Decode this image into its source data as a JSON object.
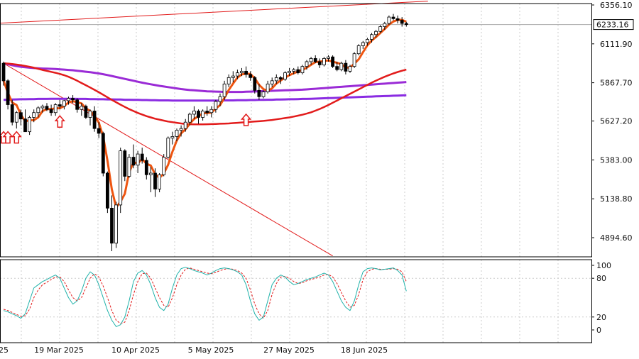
{
  "chart_data": [
    {
      "type": "candlestick",
      "title": "",
      "ylim": [
        4780,
        6380
      ],
      "y_ticks": [
        "6356.10",
        "6111.90",
        "5867.70",
        "5627.20",
        "5383.00",
        "5138.80",
        "4894.60"
      ],
      "current_price": "6233.16",
      "x_tick_labels": [
        "25",
        "19 Mar 2025",
        "10 Apr 2025",
        "5 May 2025",
        "27 May 2025",
        "18 Jun 2025"
      ],
      "grid": true,
      "colors": {
        "up": "#ffffff",
        "down": "#000000",
        "fast_ma": "#ee5511",
        "ma_50": "#e21b1b",
        "ma_200": "#9a2bd6",
        "ma_long": "#8a2be2",
        "trendline": "#e21b1b",
        "signal_arrow": "#e21b1b"
      },
      "candles": [
        [
          5990,
          6000,
          5850,
          5880
        ],
        [
          5880,
          5890,
          5700,
          5730
        ],
        [
          5730,
          5760,
          5600,
          5620
        ],
        [
          5620,
          5690,
          5580,
          5680
        ],
        [
          5680,
          5700,
          5600,
          5640
        ],
        [
          5640,
          5700,
          5560,
          5560
        ],
        [
          5560,
          5660,
          5540,
          5650
        ],
        [
          5650,
          5700,
          5620,
          5680
        ],
        [
          5680,
          5720,
          5650,
          5710
        ],
        [
          5710,
          5730,
          5680,
          5720
        ],
        [
          5720,
          5740,
          5690,
          5700
        ],
        [
          5700,
          5730,
          5660,
          5680
        ],
        [
          5680,
          5740,
          5660,
          5730
        ],
        [
          5730,
          5760,
          5700,
          5720
        ],
        [
          5720,
          5760,
          5700,
          5755
        ],
        [
          5755,
          5780,
          5730,
          5770
        ],
        [
          5770,
          5790,
          5740,
          5760
        ],
        [
          5760,
          5770,
          5680,
          5700
        ],
        [
          5700,
          5740,
          5660,
          5720
        ],
        [
          5720,
          5730,
          5640,
          5650
        ],
        [
          5650,
          5700,
          5600,
          5690
        ],
        [
          5690,
          5720,
          5560,
          5580
        ],
        [
          5580,
          5620,
          5520,
          5550
        ],
        [
          5550,
          5560,
          5280,
          5300
        ],
        [
          5300,
          5310,
          5050,
          5080
        ],
        [
          5080,
          5160,
          4810,
          4860
        ],
        [
          4860,
          5120,
          4830,
          5100
        ],
        [
          5100,
          5460,
          5050,
          5440
        ],
        [
          5440,
          5450,
          5250,
          5280
        ],
        [
          5280,
          5420,
          5270,
          5400
        ],
        [
          5400,
          5480,
          5330,
          5350
        ],
        [
          5350,
          5440,
          5300,
          5420
        ],
        [
          5420,
          5460,
          5360,
          5380
        ],
        [
          5380,
          5400,
          5260,
          5290
        ],
        [
          5290,
          5340,
          5180,
          5300
        ],
        [
          5300,
          5330,
          5150,
          5200
        ],
        [
          5200,
          5300,
          5180,
          5290
        ],
        [
          5290,
          5420,
          5280,
          5400
        ],
        [
          5400,
          5530,
          5390,
          5520
        ],
        [
          5520,
          5560,
          5480,
          5530
        ],
        [
          5530,
          5580,
          5500,
          5570
        ],
        [
          5570,
          5600,
          5530,
          5580
        ],
        [
          5580,
          5640,
          5560,
          5620
        ],
        [
          5620,
          5680,
          5600,
          5670
        ],
        [
          5670,
          5720,
          5640,
          5690
        ],
        [
          5690,
          5700,
          5610,
          5650
        ],
        [
          5650,
          5700,
          5630,
          5690
        ],
        [
          5690,
          5720,
          5660,
          5680
        ],
        [
          5680,
          5720,
          5650,
          5700
        ],
        [
          5700,
          5760,
          5680,
          5750
        ],
        [
          5750,
          5800,
          5720,
          5780
        ],
        [
          5780,
          5880,
          5760,
          5860
        ],
        [
          5860,
          5920,
          5840,
          5900
        ],
        [
          5900,
          5940,
          5870,
          5910
        ],
        [
          5910,
          5950,
          5890,
          5930
        ],
        [
          5930,
          5960,
          5910,
          5940
        ],
        [
          5940,
          5970,
          5900,
          5920
        ],
        [
          5920,
          5940,
          5880,
          5900
        ],
        [
          5900,
          5910,
          5800,
          5820
        ],
        [
          5820,
          5860,
          5760,
          5780
        ],
        [
          5780,
          5820,
          5770,
          5810
        ],
        [
          5810,
          5880,
          5800,
          5860
        ],
        [
          5860,
          5900,
          5840,
          5880
        ],
        [
          5880,
          5920,
          5860,
          5900
        ],
        [
          5900,
          5910,
          5860,
          5890
        ],
        [
          5890,
          5940,
          5880,
          5930
        ],
        [
          5930,
          5960,
          5910,
          5940
        ],
        [
          5940,
          5960,
          5920,
          5950
        ],
        [
          5950,
          5970,
          5920,
          5930
        ],
        [
          5930,
          5980,
          5920,
          5970
        ],
        [
          5970,
          6010,
          5950,
          6000
        ],
        [
          6000,
          6030,
          5980,
          6020
        ],
        [
          6020,
          6040,
          5990,
          6000
        ],
        [
          6000,
          6020,
          5960,
          5980
        ],
        [
          5980,
          6030,
          5970,
          6020
        ],
        [
          6020,
          6040,
          6000,
          6030
        ],
        [
          6030,
          6040,
          5960,
          5970
        ],
        [
          5970,
          6000,
          5940,
          5950
        ],
        [
          5950,
          6000,
          5940,
          5990
        ],
        [
          5990,
          6010,
          5920,
          5940
        ],
        [
          5940,
          5980,
          5930,
          5970
        ],
        [
          5970,
          6060,
          5960,
          6050
        ],
        [
          6050,
          6110,
          6040,
          6100
        ],
        [
          6100,
          6130,
          6080,
          6120
        ],
        [
          6120,
          6150,
          6100,
          6140
        ],
        [
          6140,
          6180,
          6120,
          6170
        ],
        [
          6170,
          6200,
          6150,
          6190
        ],
        [
          6190,
          6230,
          6180,
          6220
        ],
        [
          6220,
          6250,
          6200,
          6240
        ],
        [
          6240,
          6290,
          6230,
          6280
        ],
        [
          6280,
          6300,
          6260,
          6270
        ],
        [
          6270,
          6290,
          6240,
          6260
        ],
        [
          6260,
          6280,
          6220,
          6240
        ],
        [
          6240,
          6250,
          6220,
          6233
        ]
      ],
      "ma_50_values": [
        5990,
        5988,
        5985,
        5982,
        5978,
        5973,
        5968,
        5962,
        5955,
        5948,
        5942,
        5936,
        5930,
        5923,
        5915,
        5905,
        5893,
        5880,
        5866,
        5852,
        5838,
        5823,
        5808,
        5792,
        5776,
        5760,
        5745,
        5730,
        5716,
        5702,
        5690,
        5678,
        5668,
        5658,
        5650,
        5642,
        5636,
        5630,
        5624,
        5620,
        5616,
        5612,
        5609,
        5607,
        5606,
        5606,
        5606,
        5607,
        5608,
        5609,
        5610,
        5611,
        5612,
        5614,
        5616,
        5618,
        5620,
        5622,
        5624,
        5626,
        5628,
        5631,
        5634,
        5638,
        5642,
        5646,
        5650,
        5655,
        5661,
        5667,
        5674,
        5682,
        5692,
        5703,
        5715,
        5728,
        5742,
        5756,
        5770,
        5784,
        5798,
        5812,
        5826,
        5840,
        5854,
        5868,
        5881,
        5893,
        5905,
        5916,
        5926,
        5935,
        5943,
        5950
      ],
      "ma_200_values": [
        5990,
        5984,
        5978,
        5972,
        5968,
        5965,
        5962,
        5960,
        5958,
        5957,
        5956,
        5955,
        5954,
        5952,
        5950,
        5948,
        5946,
        5943,
        5940,
        5937,
        5934,
        5930,
        5926,
        5921,
        5916,
        5910,
        5904,
        5898,
        5892,
        5886,
        5880,
        5874,
        5868,
        5863,
        5858,
        5853,
        5848,
        5844,
        5840,
        5836,
        5832,
        5828,
        5825,
        5822,
        5820,
        5818,
        5816,
        5814,
        5813,
        5812,
        5811,
        5810,
        5810,
        5810,
        5810,
        5810,
        5811,
        5812,
        5813,
        5814,
        5815,
        5816,
        5817,
        5818,
        5819,
        5820,
        5821,
        5822,
        5823,
        5824,
        5826,
        5828,
        5830,
        5832,
        5834,
        5836,
        5838,
        5840,
        5842,
        5844,
        5846,
        5848,
        5850,
        5852,
        5854,
        5856,
        5858,
        5860,
        5862,
        5864,
        5866,
        5868,
        5870,
        5872
      ],
      "ma_long_values": [
        5760,
        5761,
        5762,
        5763,
        5764,
        5764,
        5765,
        5765,
        5766,
        5766,
        5766,
        5767,
        5767,
        5767,
        5767,
        5767,
        5767,
        5766,
        5766,
        5766,
        5765,
        5765,
        5764,
        5764,
        5763,
        5763,
        5762,
        5762,
        5761,
        5761,
        5760,
        5760,
        5759,
        5759,
        5758,
        5758,
        5757,
        5757,
        5757,
        5756,
        5756,
        5756,
        5756,
        5756,
        5756,
        5756,
        5756,
        5756,
        5756,
        5756,
        5756,
        5757,
        5757,
        5757,
        5758,
        5758,
        5758,
        5759,
        5759,
        5760,
        5760,
        5761,
        5761,
        5762,
        5762,
        5763,
        5764,
        5764,
        5765,
        5766,
        5766,
        5767,
        5768,
        5769,
        5770,
        5771,
        5772,
        5773,
        5774,
        5775,
        5776,
        5777,
        5778,
        5779,
        5780,
        5781,
        5782,
        5783,
        5784,
        5785,
        5786,
        5787,
        5788,
        5789
      ],
      "signal_arrows": [
        [
          0,
          5520
        ],
        [
          1,
          5520
        ],
        [
          3,
          5520
        ],
        [
          13,
          5620
        ],
        [
          56,
          5630
        ]
      ],
      "trendlines": [
        {
          "from": [
            -2,
            6240
          ],
          "to": [
            98,
            6380
          ]
        },
        {
          "from": [
            0,
            5990
          ],
          "to": [
            76,
            4780
          ]
        }
      ]
    },
    {
      "type": "line",
      "title": "",
      "ylim": [
        0,
        100
      ],
      "y_tick_labels": [
        "100",
        "80",
        "20",
        "0"
      ],
      "y_tick_values": [
        100,
        80,
        20,
        0
      ],
      "series": [
        {
          "color": "#20b2aa",
          "style": "solid",
          "values": [
            30,
            28,
            25,
            22,
            18,
            25,
            45,
            65,
            70,
            75,
            78,
            82,
            85,
            80,
            65,
            50,
            40,
            45,
            60,
            80,
            90,
            85,
            70,
            50,
            30,
            15,
            5,
            8,
            20,
            45,
            75,
            88,
            92,
            85,
            70,
            50,
            35,
            30,
            40,
            65,
            85,
            95,
            97,
            95,
            92,
            90,
            88,
            85,
            88,
            92,
            95,
            96,
            95,
            93,
            90,
            85,
            70,
            45,
            25,
            15,
            20,
            45,
            70,
            80,
            85,
            82,
            75,
            70,
            72,
            75,
            78,
            80,
            82,
            85,
            88,
            85,
            75,
            60,
            45,
            35,
            30,
            45,
            70,
            90,
            95,
            96,
            95,
            93,
            94,
            95,
            96,
            92,
            85,
            60
          ]
        },
        {
          "color": "#e21b1b",
          "style": "dashed",
          "values": [
            32,
            30,
            27,
            24,
            21,
            22,
            32,
            50,
            62,
            70,
            74,
            78,
            82,
            82,
            75,
            62,
            50,
            45,
            50,
            65,
            80,
            87,
            82,
            68,
            50,
            30,
            15,
            10,
            12,
            30,
            55,
            75,
            87,
            88,
            80,
            65,
            50,
            38,
            35,
            50,
            70,
            85,
            94,
            96,
            94,
            92,
            90,
            88,
            87,
            89,
            92,
            94,
            95,
            94,
            92,
            88,
            80,
            62,
            40,
            25,
            18,
            30,
            55,
            72,
            82,
            83,
            80,
            75,
            72,
            73,
            76,
            78,
            80,
            82,
            85,
            86,
            82,
            72,
            58,
            45,
            35,
            38,
            55,
            78,
            90,
            94,
            95,
            94,
            94,
            94,
            95,
            94,
            90,
            75
          ]
        }
      ]
    }
  ]
}
